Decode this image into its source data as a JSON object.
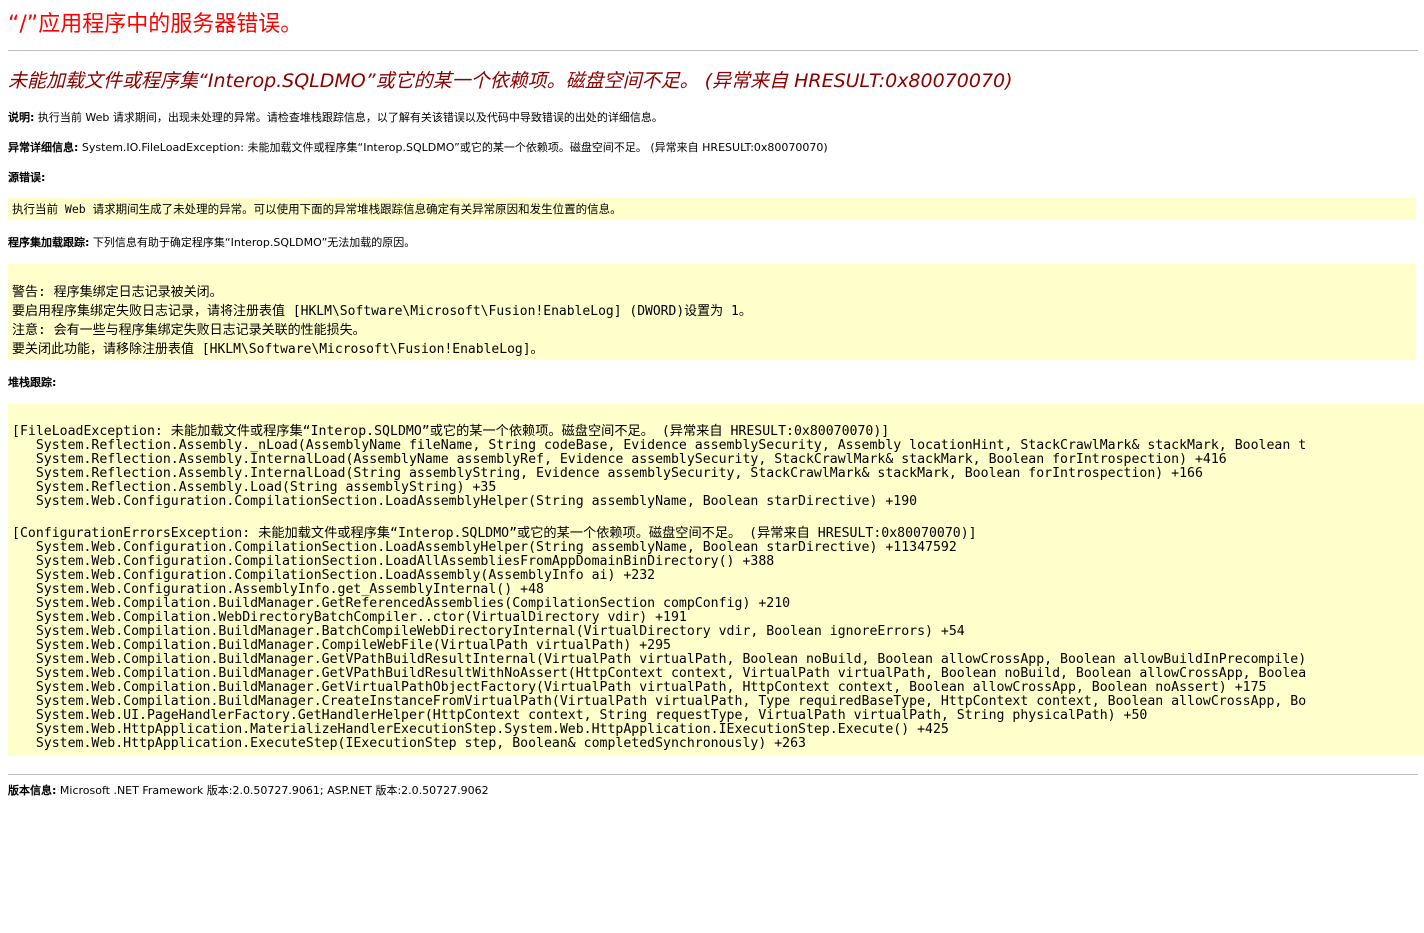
{
  "page": {
    "title": "“/”应用程序中的服务器错误。",
    "error_title": "未能加载文件或程序集“Interop.SQLDMO”或它的某一个依赖项。磁盘空间不足。 (异常来自 HRESULT:0x80070070)"
  },
  "description": {
    "label": "说明:",
    "text": " 执行当前 Web 请求期间，出现未处理的异常。请检查堆栈跟踪信息，以了解有关该错误以及代码中导致错误的出处的详细信息。"
  },
  "exception_details": {
    "label": "异常详细信息:",
    "text": " System.IO.FileLoadException: 未能加载文件或程序集“Interop.SQLDMO”或它的某一个依赖项。磁盘空间不足。 (异常来自 HRESULT:0x80070070)"
  },
  "source_error": {
    "label": "源错误:",
    "text": "执行当前 Web 请求期间生成了未处理的异常。可以使用下面的异常堆栈跟踪信息确定有关异常原因和发生位置的信息。"
  },
  "assembly_trace": {
    "label": "程序集加载跟踪:",
    "text": " 下列信息有助于确定程序集“Interop.SQLDMO”无法加载的原因。",
    "lines": [
      "警告: 程序集绑定日志记录被关闭。",
      "要启用程序集绑定失败日志记录，请将注册表值 [HKLM\\Software\\Microsoft\\Fusion!EnableLog] (DWORD)设置为 1。",
      "注意: 会有一些与程序集绑定失败日志记录关联的性能损失。",
      "要关闭此功能，请移除注册表值 [HKLM\\Software\\Microsoft\\Fusion!EnableLog]。"
    ]
  },
  "stack_trace": {
    "label": "堆栈跟踪:",
    "block1": [
      "[FileLoadException: 未能加载文件或程序集“Interop.SQLDMO”或它的某一个依赖项。磁盘空间不足。 (异常来自 HRESULT:0x80070070)]",
      "   System.Reflection.Assembly._nLoad(AssemblyName fileName, String codeBase, Evidence assemblySecurity, Assembly locationHint, StackCrawlMark& stackMark, Boolean t",
      "   System.Reflection.Assembly.InternalLoad(AssemblyName assemblyRef, Evidence assemblySecurity, StackCrawlMark& stackMark, Boolean forIntrospection) +416",
      "   System.Reflection.Assembly.InternalLoad(String assemblyString, Evidence assemblySecurity, StackCrawlMark& stackMark, Boolean forIntrospection) +166",
      "   System.Reflection.Assembly.Load(String assemblyString) +35",
      "   System.Web.Configuration.CompilationSection.LoadAssemblyHelper(String assemblyName, Boolean starDirective) +190"
    ],
    "block2": [
      "[ConfigurationErrorsException: 未能加载文件或程序集“Interop.SQLDMO”或它的某一个依赖项。磁盘空间不足。 (异常来自 HRESULT:0x80070070)]",
      "   System.Web.Configuration.CompilationSection.LoadAssemblyHelper(String assemblyName, Boolean starDirective) +11347592",
      "   System.Web.Configuration.CompilationSection.LoadAllAssembliesFromAppDomainBinDirectory() +388",
      "   System.Web.Configuration.CompilationSection.LoadAssembly(AssemblyInfo ai) +232",
      "   System.Web.Configuration.AssemblyInfo.get_AssemblyInternal() +48",
      "   System.Web.Compilation.BuildManager.GetReferencedAssemblies(CompilationSection compConfig) +210",
      "   System.Web.Compilation.WebDirectoryBatchCompiler..ctor(VirtualDirectory vdir) +191",
      "   System.Web.Compilation.BuildManager.BatchCompileWebDirectoryInternal(VirtualDirectory vdir, Boolean ignoreErrors) +54",
      "   System.Web.Compilation.BuildManager.CompileWebFile(VirtualPath virtualPath) +295",
      "   System.Web.Compilation.BuildManager.GetVPathBuildResultInternal(VirtualPath virtualPath, Boolean noBuild, Boolean allowCrossApp, Boolean allowBuildInPrecompile)",
      "   System.Web.Compilation.BuildManager.GetVPathBuildResultWithNoAssert(HttpContext context, VirtualPath virtualPath, Boolean noBuild, Boolean allowCrossApp, Boolea",
      "   System.Web.Compilation.BuildManager.GetVirtualPathObjectFactory(VirtualPath virtualPath, HttpContext context, Boolean allowCrossApp, Boolean noAssert) +175",
      "   System.Web.Compilation.BuildManager.CreateInstanceFromVirtualPath(VirtualPath virtualPath, Type requiredBaseType, HttpContext context, Boolean allowCrossApp, Bo",
      "   System.Web.UI.PageHandlerFactory.GetHandlerHelper(HttpContext context, String requestType, VirtualPath virtualPath, String physicalPath) +50",
      "   System.Web.HttpApplication.MaterializeHandlerExecutionStep.System.Web.HttpApplication.IExecutionStep.Execute() +425",
      "   System.Web.HttpApplication.ExecuteStep(IExecutionStep step, Boolean& completedSynchronously) +263"
    ]
  },
  "version_info": {
    "label": "版本信息:",
    "text": " Microsoft .NET Framework 版本:2.0.50727.9061; ASP.NET 版本:2.0.50727.9062"
  },
  "colors": {
    "title": "#ff0000",
    "error_title": "#8b0000",
    "code_background": "#ffffcc",
    "rule": "#c0c0c0"
  }
}
